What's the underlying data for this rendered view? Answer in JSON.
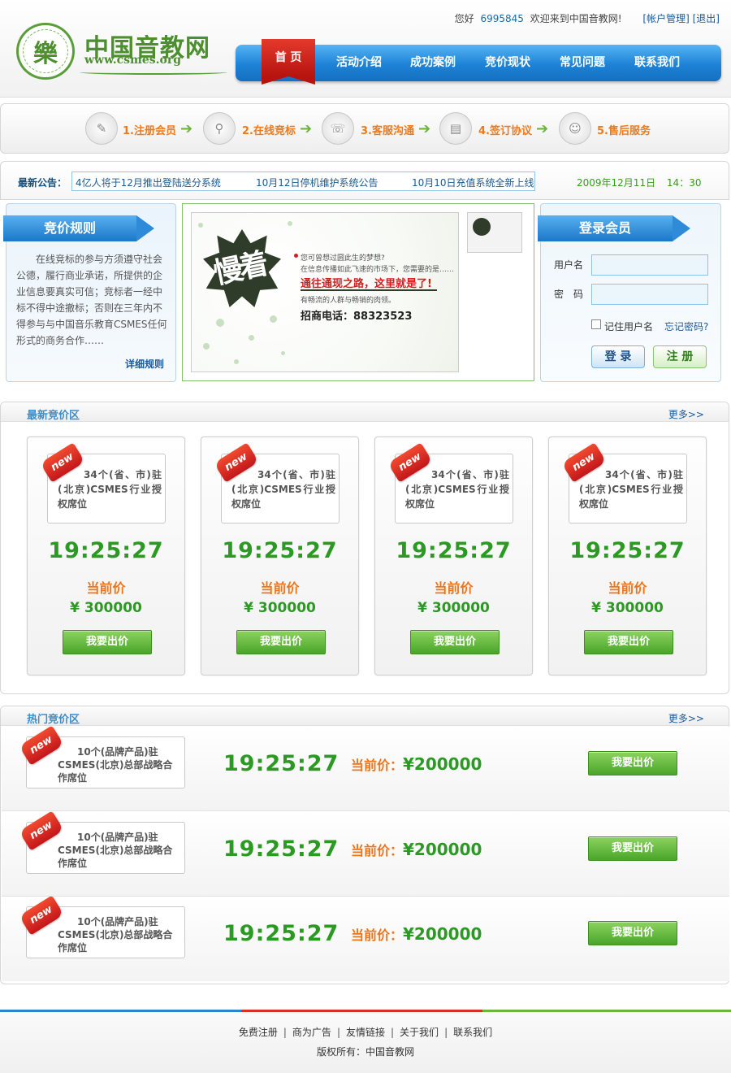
{
  "topbar": {
    "greeting": "您好",
    "user_id": "6995845",
    "welcome": "欢迎来到中国音教网!",
    "account_link": "[帐户管理]",
    "logout_link": "[退出]"
  },
  "logo": {
    "name": "中国音教网",
    "url": "www.csmes.org"
  },
  "nav": {
    "home": "首 页",
    "items": [
      "活动介绍",
      "成功案例",
      "竞价现状",
      "常见问题",
      "联系我们"
    ]
  },
  "steps": [
    "1.注册会员",
    "2.在线竞标",
    "3.客服沟通",
    "4.签订协议",
    "5.售后服务"
  ],
  "notice": {
    "title": "最新公告：",
    "items": [
      "4亿人将于12月推出登陆送分系统",
      "10月12日停机维护系统公告",
      "10月10日充值系统全新上线"
    ],
    "date": "2009年12月11日",
    "time": "14：30"
  },
  "rules": {
    "title": "竞价规则",
    "text": "在线竞标的参与方须遵守社会公德，履行商业承诺，所提供的企业信息要真实可信；竞标者一经中标不得中途撤标；否则在三年内不得参与与中国音乐教育CSMES任何形式的商务合作……",
    "more": "详细规则"
  },
  "banner": {
    "slogan": "慢着",
    "line1": "您可曾想过圆此生的梦想?",
    "line2": "在信息传播如此飞速的市场下，您需要的是……",
    "headline": "通往通现之路，这里就是了!",
    "line3": "有畅流的人群与畅销的肉领。",
    "phone": "招商电话：88323523"
  },
  "login": {
    "title": "登录会员",
    "username_label": "用户名",
    "password_label": "密　码",
    "remember": "记住用户名",
    "forgot": "忘记密码?",
    "login_btn": "登 录",
    "register_btn": "注 册"
  },
  "latest": {
    "title": "最新竞价区",
    "more": "更多>>",
    "cards": [
      {
        "tag": "new",
        "title": "34个(省、市)驻(北京)CSMES行业授权席位",
        "timer": "19:25:27",
        "price_label": "当前价",
        "price": "¥ 300000",
        "button": "我要出价"
      },
      {
        "tag": "new",
        "title": "34个(省、市)驻(北京)CSMES行业授权席位",
        "timer": "19:25:27",
        "price_label": "当前价",
        "price": "¥ 300000",
        "button": "我要出价"
      },
      {
        "tag": "new",
        "title": "34个(省、市)驻(北京)CSMES行业授权席位",
        "timer": "19:25:27",
        "price_label": "当前价",
        "price": "¥ 300000",
        "button": "我要出价"
      },
      {
        "tag": "new",
        "title": "34个(省、市)驻(北京)CSMES行业授权席位",
        "timer": "19:25:27",
        "price_label": "当前价",
        "price": "¥ 300000",
        "button": "我要出价"
      }
    ]
  },
  "hot": {
    "title": "热门竞价区",
    "more": "更多>>",
    "rows": [
      {
        "tag": "new",
        "title": "10个(品牌产品)驻CSMES(北京)总部战略合作席位",
        "timer": "19:25:27",
        "price_label": "当前价：",
        "price": "¥200000",
        "button": "我要出价"
      },
      {
        "tag": "new",
        "title": "10个(品牌产品)驻CSMES(北京)总部战略合作席位",
        "timer": "19:25:27",
        "price_label": "当前价：",
        "price": "¥200000",
        "button": "我要出价"
      },
      {
        "tag": "new",
        "title": "10个(品牌产品)驻CSMES(北京)总部战略合作席位",
        "timer": "19:25:27",
        "price_label": "当前价：",
        "price": "¥200000",
        "button": "我要出价"
      }
    ]
  },
  "footer": {
    "links": [
      "免费注册",
      "商为广告",
      "友情链接",
      "关于我们",
      "联系我们"
    ],
    "copyright": "版权所有：中国音教网"
  },
  "colors": {
    "nav_blue": "#1d82d6",
    "home_red": "#c4161a",
    "accent_green": "#2b9a23",
    "accent_orange": "#f0751a",
    "link_blue": "#1a5a9a"
  }
}
